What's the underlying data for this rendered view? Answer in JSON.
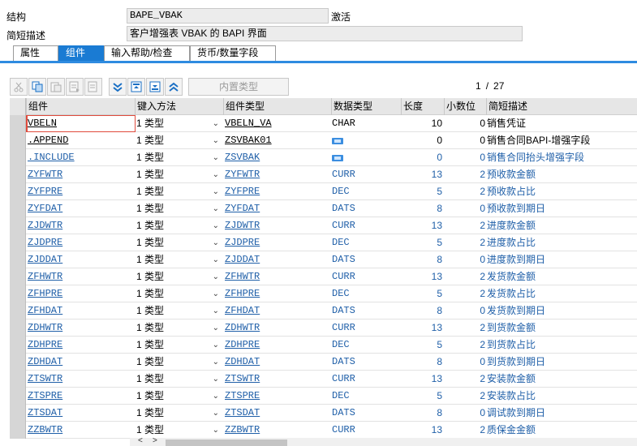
{
  "header": {
    "structure_label": "结构",
    "structure_value": "BAPE_VBAK",
    "status": "激活",
    "desc_label": "简短描述",
    "desc_value": "客户增强表 VBAK 的 BAPI 界面"
  },
  "tabs": [
    {
      "label": "属性",
      "active": false
    },
    {
      "label": "组件",
      "active": true
    },
    {
      "label": "输入帮助/检查",
      "active": false
    },
    {
      "label": "货币/数量字段",
      "active": false
    }
  ],
  "toolbar": {
    "builtin_type_label": "内置类型",
    "icons": [
      "cut-icon",
      "copy-icon",
      "paste-icon",
      "insert-row-icon",
      "delete-row-icon",
      "expand-icon",
      "top-icon",
      "bottom-icon",
      "collapse-icon"
    ]
  },
  "pager": {
    "current": "1",
    "separator": "/",
    "total": "27"
  },
  "table": {
    "headers": [
      "组件",
      "键入方法",
      "组件类型",
      "数据类型",
      "长度",
      "小数位",
      "简短描述"
    ],
    "rows": [
      {
        "comp": "VBELN",
        "method": "1 类型",
        "type": "VBELN_VA",
        "dtype": "CHAR",
        "len": "10",
        "dec": "0",
        "desc": "销售凭证",
        "style": "black"
      },
      {
        "comp": ".APPEND",
        "method": "1 类型",
        "type": "ZSVBAK01",
        "dtype": "ref-icon",
        "len": "0",
        "dec": "0",
        "desc": "销售合同BAPI-增强字段",
        "style": "black"
      },
      {
        "comp": ".INCLUDE",
        "method": "1 类型",
        "type": "ZSVBAK",
        "dtype": "ref-icon",
        "len": "0",
        "dec": "0",
        "desc": "销售合同抬头增强字段",
        "style": "blue"
      },
      {
        "comp": "ZYFWTR",
        "method": "1 类型",
        "type": "ZYFWTR",
        "dtype": "CURR",
        "len": "13",
        "dec": "2",
        "desc": "预收款金额",
        "style": "blue"
      },
      {
        "comp": "ZYFPRE",
        "method": "1 类型",
        "type": "ZYFPRE",
        "dtype": "DEC",
        "len": "5",
        "dec": "2",
        "desc": "预收款占比",
        "style": "blue"
      },
      {
        "comp": "ZYFDAT",
        "method": "1 类型",
        "type": "ZYFDAT",
        "dtype": "DATS",
        "len": "8",
        "dec": "0",
        "desc": "预收款到期日",
        "style": "blue"
      },
      {
        "comp": "ZJDWTR",
        "method": "1 类型",
        "type": "ZJDWTR",
        "dtype": "CURR",
        "len": "13",
        "dec": "2",
        "desc": "进度款金额",
        "style": "blue"
      },
      {
        "comp": "ZJDPRE",
        "method": "1 类型",
        "type": "ZJDPRE",
        "dtype": "DEC",
        "len": "5",
        "dec": "2",
        "desc": "进度款占比",
        "style": "blue"
      },
      {
        "comp": "ZJDDAT",
        "method": "1 类型",
        "type": "ZJDDAT",
        "dtype": "DATS",
        "len": "8",
        "dec": "0",
        "desc": "进度款到期日",
        "style": "blue"
      },
      {
        "comp": "ZFHWTR",
        "method": "1 类型",
        "type": "ZFHWTR",
        "dtype": "CURR",
        "len": "13",
        "dec": "2",
        "desc": "发货款金额",
        "style": "blue"
      },
      {
        "comp": "ZFHPRE",
        "method": "1 类型",
        "type": "ZFHPRE",
        "dtype": "DEC",
        "len": "5",
        "dec": "2",
        "desc": "发货款占比",
        "style": "blue"
      },
      {
        "comp": "ZFHDAT",
        "method": "1 类型",
        "type": "ZFHDAT",
        "dtype": "DATS",
        "len": "8",
        "dec": "0",
        "desc": "发货款到期日",
        "style": "blue"
      },
      {
        "comp": "ZDHWTR",
        "method": "1 类型",
        "type": "ZDHWTR",
        "dtype": "CURR",
        "len": "13",
        "dec": "2",
        "desc": "到货款金额",
        "style": "blue"
      },
      {
        "comp": "ZDHPRE",
        "method": "1 类型",
        "type": "ZDHPRE",
        "dtype": "DEC",
        "len": "5",
        "dec": "2",
        "desc": "到货款占比",
        "style": "blue"
      },
      {
        "comp": "ZDHDAT",
        "method": "1 类型",
        "type": "ZDHDAT",
        "dtype": "DATS",
        "len": "8",
        "dec": "0",
        "desc": "到货款到期日",
        "style": "blue"
      },
      {
        "comp": "ZTSWTR",
        "method": "1 类型",
        "type": "ZTSWTR",
        "dtype": "CURR",
        "len": "13",
        "dec": "2",
        "desc": "安装款金额",
        "style": "blue"
      },
      {
        "comp": "ZTSPRE",
        "method": "1 类型",
        "type": "ZTSPRE",
        "dtype": "DEC",
        "len": "5",
        "dec": "2",
        "desc": "安装款占比",
        "style": "blue"
      },
      {
        "comp": "ZTSDAT",
        "method": "1 类型",
        "type": "ZTSDAT",
        "dtype": "DATS",
        "len": "8",
        "dec": "0",
        "desc": "调试款到期日",
        "style": "blue"
      },
      {
        "comp": "ZZBWTR",
        "method": "1 类型",
        "type": "ZZBWTR",
        "dtype": "CURR",
        "len": "13",
        "dec": "2",
        "desc": "质保金金额",
        "style": "blue"
      }
    ]
  },
  "colors": {
    "accent": "#1a7bd3",
    "link": "#1f5fa8",
    "focus": "#e04a3c"
  }
}
